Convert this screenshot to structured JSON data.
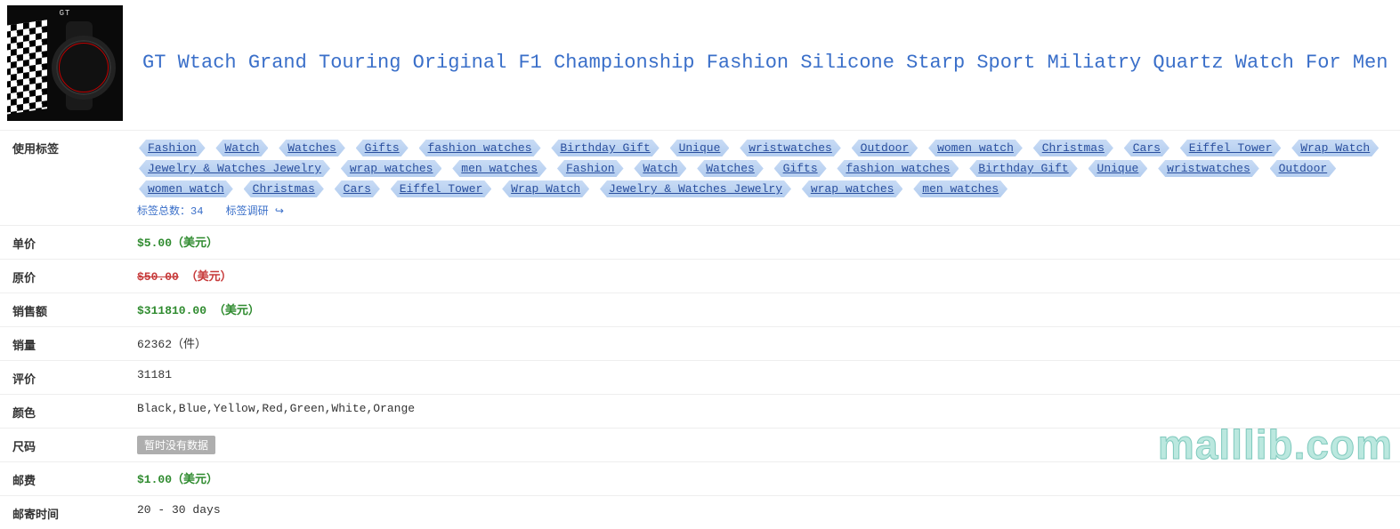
{
  "product": {
    "title": "GT Wtach Grand Touring Original F1 Championship Fashion Silicone Starp Sport Miliatry Quartz Watch For Men",
    "image_alt": "GT Grand Touring Watch"
  },
  "labels": {
    "tags": "使用标签",
    "unit_price": "单价",
    "original_price": "原价",
    "sales_amount": "销售额",
    "sales_volume": "销量",
    "reviews": "评价",
    "color": "颜色",
    "size": "尺码",
    "shipping": "邮费",
    "shipping_time": "邮寄时间"
  },
  "tags": {
    "items": [
      "Fashion",
      "Watch",
      "Watches",
      "Gifts",
      "fashion watches",
      "Birthday Gift",
      "Unique",
      "wristwatches",
      "Outdoor",
      "women watch",
      "Christmas",
      "Cars",
      "Eiffel Tower",
      "Wrap Watch",
      "Jewelry & Watches Jewelry",
      "wrap watches",
      "men watches",
      "Fashion",
      "Watch",
      "Watches",
      "Gifts",
      "fashion watches",
      "Birthday Gift",
      "Unique",
      "wristwatches",
      "Outdoor",
      "women watch",
      "Christmas",
      "Cars",
      "Eiffel Tower",
      "Wrap Watch",
      "Jewelry & Watches Jewelry",
      "wrap watches",
      "men watches"
    ],
    "total_label": "标签总数：34",
    "research_label": "标签调研"
  },
  "values": {
    "unit_price": "$5.00（美元）",
    "original_price_strike": "$50.00",
    "original_price_suffix": " （美元）",
    "sales_amount": "$311810.00 （美元）",
    "sales_volume": "62362（件）",
    "reviews": "31181",
    "color": "Black,Blue,Yellow,Red,Green,White,Orange",
    "size_nodata": "暂时没有数据",
    "shipping": "$1.00（美元）",
    "shipping_time": "20 - 30 days"
  },
  "watermark": "malllib.com"
}
